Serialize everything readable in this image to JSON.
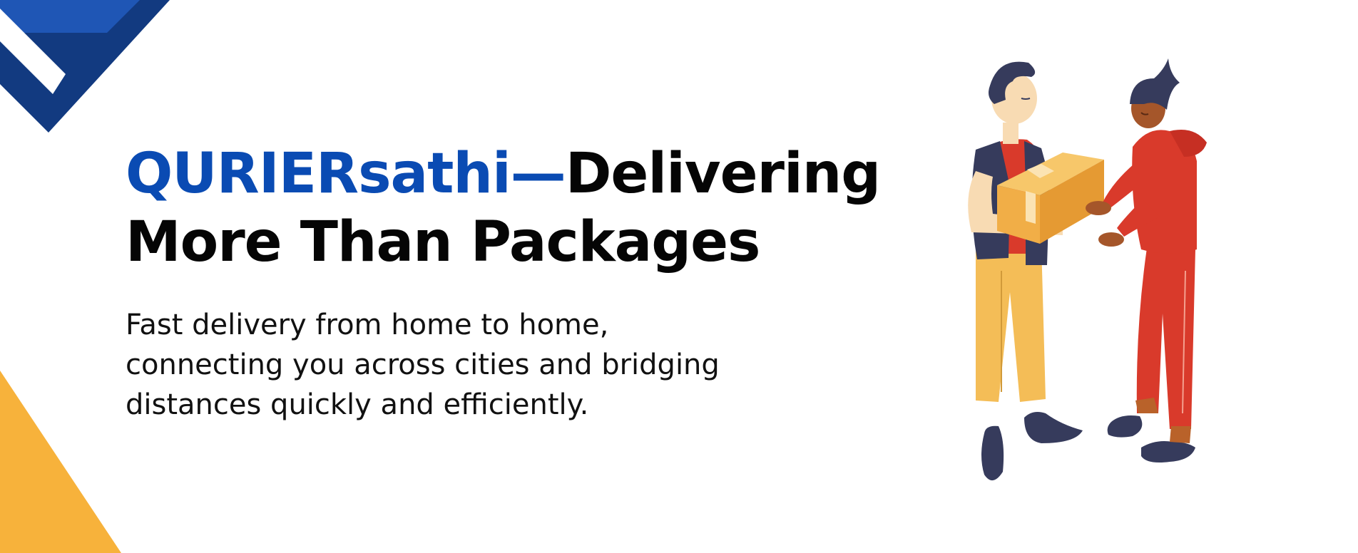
{
  "hero": {
    "brand": "QURIERsathi",
    "dash": "—",
    "headline_line1": "Delivering",
    "headline_line2": "More Than Packages",
    "subtext": "Fast delivery from home to home, connecting you across cities and bridging distances quickly and efficiently."
  },
  "colors": {
    "brand_blue": "#0a4bb3",
    "navy": "#123a80",
    "amber": "#f7b23b",
    "red": "#d93a2b",
    "text_dark": "#050505"
  },
  "decor": {
    "top_left": "blue-chevron-shape",
    "bottom_left": "yellow-triangle-shape",
    "illustration": "courier-handing-package-to-customer"
  }
}
